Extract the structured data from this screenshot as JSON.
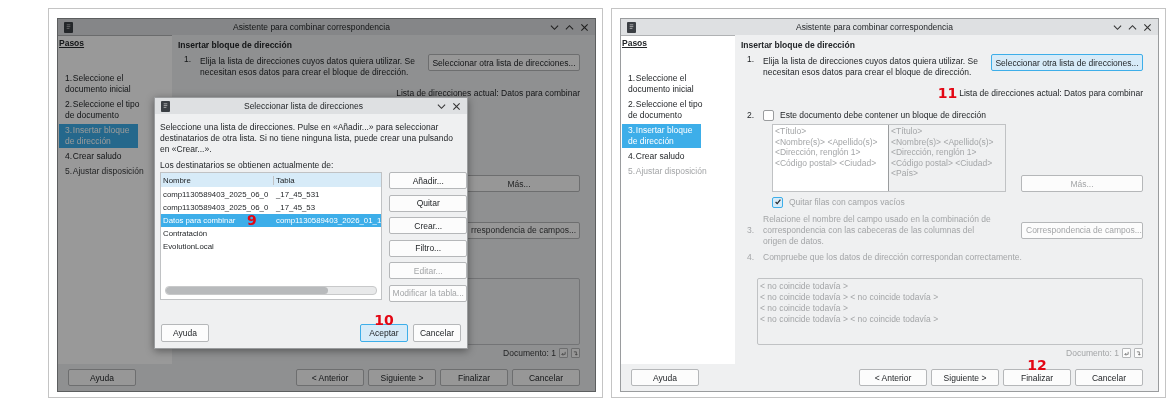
{
  "panels": [
    {
      "wizard": {
        "title": "Asistente para combinar correspondencia",
        "dimmed": true,
        "steps_heading": "Pasos",
        "steps": [
          {
            "number": "1.",
            "label": "Seleccione el documento inicial",
            "selected": false,
            "disabled": false
          },
          {
            "number": "2.",
            "label": "Seleccione el tipo de documento",
            "selected": false,
            "disabled": false
          },
          {
            "number": "3.",
            "label": "Insertar bloque de dirección",
            "selected": true,
            "disabled": false
          },
          {
            "number": "4.",
            "label": "Crear saludo",
            "selected": false,
            "disabled": false
          },
          {
            "number": "5.",
            "label": "Ajustar disposición",
            "selected": false,
            "disabled": true
          }
        ],
        "heading": "Insertar bloque de dirección",
        "step1": {
          "number": "1.",
          "text": "Elija la lista de direcciones cuyos datos quiera utilizar. Se necesitan esos datos para crear el bloque de dirección.",
          "button": {
            "label": "Seleccionar otra lista de direcciones...",
            "focused": false
          }
        },
        "current_list": {
          "text": "Lista de direcciones actual: Datos para combinar"
        },
        "more_button": {
          "label": "Más...",
          "disabled": true
        },
        "mapping_button": {
          "label": "rrespondencia de campos...",
          "disabled": true
        },
        "document_label": "Documento: 1",
        "buttons": [
          {
            "label": "Ayuda",
            "kind": "help",
            "focused": false
          },
          {
            "label": "< Anterior",
            "kind": "nav",
            "focused": false
          },
          {
            "label": "Siguiente >",
            "kind": "nav",
            "focused": false
          },
          {
            "label": "Finalizar",
            "kind": "nav",
            "focused": false
          },
          {
            "label": "Cancelar",
            "kind": "nav",
            "focused": false
          }
        ]
      },
      "dialog": {
        "title": "Seleccionar lista de direcciones",
        "intro": "Seleccione una lista de direcciones. Pulse en «Añadir...» para seleccionar destinatarios de otra lista. Si no tiene ninguna lista, puede crear una pulsando en «Crear...».",
        "source_label": "Los destinatarios se obtienen actualmente de:",
        "columns": [
          "Nombre",
          "Tabla"
        ],
        "rows": [
          {
            "cells": [
              "comp1130589403_2025_06_0",
              "_17_45_531"
            ],
            "selected": false
          },
          {
            "cells": [
              "comp1130589403_2025_06_0",
              "_17_45_53"
            ],
            "selected": false
          },
          {
            "cells": [
              "Datos para combinar",
              "comp1130589403_2026_01_1"
            ],
            "selected": true,
            "marker": "9"
          },
          {
            "cells": [
              "Contratación",
              ""
            ],
            "selected": false
          },
          {
            "cells": [
              "EvolutionLocal",
              ""
            ],
            "selected": false
          }
        ],
        "side_buttons": [
          {
            "label": "Añadir...",
            "disabled": false
          },
          {
            "label": "Quitar",
            "disabled": false
          },
          {
            "label": "Crear...",
            "disabled": false
          },
          {
            "label": "Filtro...",
            "disabled": false
          },
          {
            "label": "Editar...",
            "disabled": true
          },
          {
            "label": "Modificar la tabla...",
            "disabled": true
          }
        ],
        "buttons": [
          {
            "label": "Ayuda",
            "kind": "help",
            "focused": false
          },
          {
            "label": "Aceptar",
            "kind": "nav",
            "focused": true,
            "marker": "10"
          },
          {
            "label": "Cancelar",
            "kind": "nav",
            "focused": false
          }
        ]
      }
    },
    {
      "wizard": {
        "title": "Asistente para combinar correspondencia",
        "dimmed": false,
        "steps_heading": "Pasos",
        "steps": [
          {
            "number": "1.",
            "label": "Seleccione el documento inicial",
            "selected": false,
            "disabled": false
          },
          {
            "number": "2.",
            "label": "Seleccione el tipo de documento",
            "selected": false,
            "disabled": false
          },
          {
            "number": "3.",
            "label": "Insertar bloque de dirección",
            "selected": true,
            "disabled": false
          },
          {
            "number": "4.",
            "label": "Crear saludo",
            "selected": false,
            "disabled": false
          },
          {
            "number": "5.",
            "label": "Ajustar disposición",
            "selected": false,
            "disabled": true
          }
        ],
        "heading": "Insertar bloque de dirección",
        "step1": {
          "number": "1.",
          "text": "Elija la lista de direcciones cuyos datos quiera utilizar. Se necesitan esos datos para crear el bloque de dirección.",
          "button": {
            "label": "Seleccionar otra lista de direcciones...",
            "focused": true
          }
        },
        "current_list": {
          "text": "Lista de direcciones actual: Datos para combinar",
          "marker": "11"
        },
        "step2": {
          "number": "2.",
          "label": "Este documento debe contener un bloque de dirección",
          "checked": false
        },
        "address_blocks": [
          {
            "lines": [
              "<Título>",
              "<Nombre(s)> <Apellido(s)>",
              "<Dirección, renglón 1>",
              "<Código postal> <Ciudad>"
            ],
            "selected": true
          },
          {
            "lines": [
              "<Título>",
              "<Nombre(s)> <Apellido(s)>",
              "<Dirección, renglón 1>",
              "<Código postal> <Ciudad>",
              "<País>"
            ],
            "selected": false
          }
        ],
        "more_button": {
          "label": "Más...",
          "disabled": true
        },
        "remove_empty": {
          "label": "Quitar filas con campos vacíos",
          "checked": true,
          "disabled": true
        },
        "step3": {
          "number": "3.",
          "text": "Relacione el nombre del campo usado en la combinación de correspondencia con las cabeceras de las columnas del origen de datos."
        },
        "mapping_button": {
          "label": "Correspondencia de campos...",
          "disabled": true
        },
        "step4": {
          "number": "4.",
          "text": "Compruebe que los datos de dirección correspondan correctamente."
        },
        "preview_lines": [
          "< no coincide todavía >",
          "< no coincide todavía > < no coincide todavía >",
          "< no coincide todavía >",
          "< no coincide todavía > < no coincide todavía >"
        ],
        "document_label": "Documento: 1",
        "buttons": [
          {
            "label": "Ayuda",
            "kind": "help",
            "focused": false
          },
          {
            "label": "< Anterior",
            "kind": "nav",
            "focused": false
          },
          {
            "label": "Siguiente >",
            "kind": "nav",
            "focused": false
          },
          {
            "label": "Finalizar",
            "kind": "nav",
            "focused": false,
            "marker": "12"
          },
          {
            "label": "Cancelar",
            "kind": "nav",
            "focused": false
          }
        ]
      }
    }
  ]
}
